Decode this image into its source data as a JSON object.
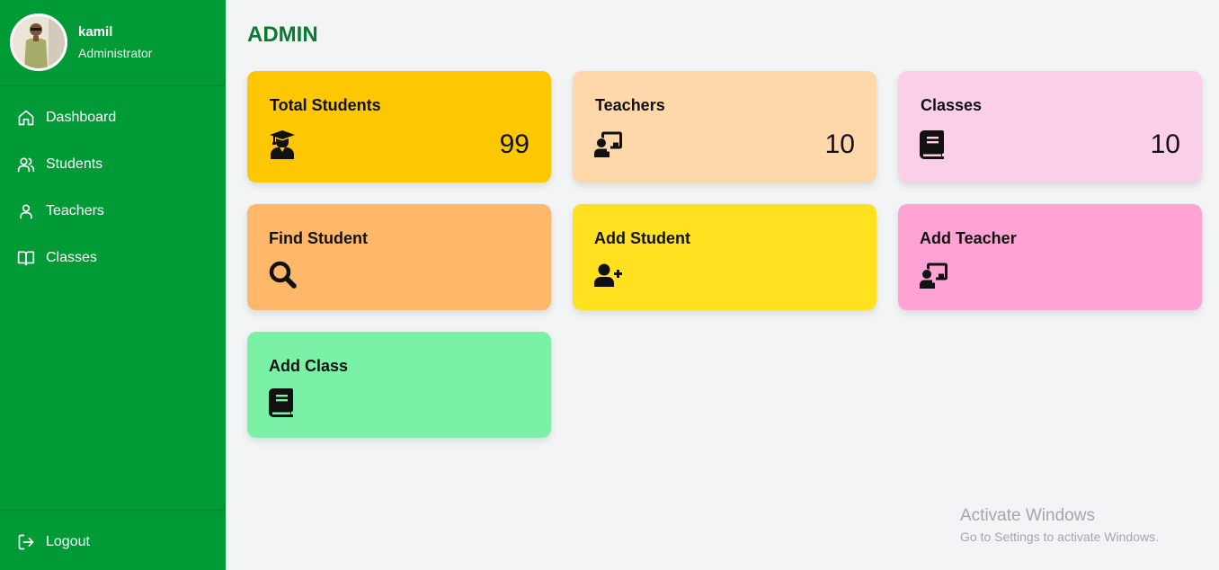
{
  "sidebar": {
    "user": {
      "name": "kamil",
      "role": "Administrator"
    },
    "items": [
      {
        "label": "Dashboard",
        "icon": "home-icon"
      },
      {
        "label": "Students",
        "icon": "users-icon"
      },
      {
        "label": "Teachers",
        "icon": "user-icon"
      },
      {
        "label": "Classes",
        "icon": "book-open-icon"
      }
    ],
    "logout_label": "Logout"
  },
  "main": {
    "title": "ADMIN",
    "stats": [
      {
        "title": "Total Students",
        "value": "99",
        "icon": "graduate-icon",
        "color": "#fdc701"
      },
      {
        "title": "Teachers",
        "value": "10",
        "icon": "chalkboard-teacher-icon",
        "color": "#fed7aa"
      },
      {
        "title": "Classes",
        "value": "10",
        "icon": "book-icon",
        "color": "#fbcfe8"
      }
    ],
    "actions": [
      {
        "title": "Find Student",
        "icon": "search-icon",
        "color": "#ffb86a"
      },
      {
        "title": "Add Student",
        "icon": "user-plus-icon",
        "color": "#ffe120"
      },
      {
        "title": "Add Teacher",
        "icon": "chalkboard-teacher-icon",
        "color": "#ffa3d5"
      },
      {
        "title": "Add Class",
        "icon": "book-icon",
        "color": "#7bf1a8"
      }
    ]
  },
  "watermark": {
    "title": "Activate Windows",
    "subtitle": "Go to Settings to activate Windows."
  }
}
